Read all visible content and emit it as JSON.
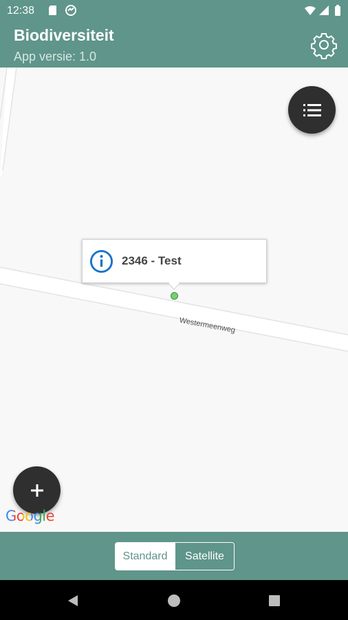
{
  "status_bar": {
    "time": "12:38"
  },
  "app_bar": {
    "title": "Biodiversiteit",
    "subtitle": "App versie: 1.0"
  },
  "map": {
    "info_window": {
      "text": "2346 - Test"
    },
    "street_name": "Westermeenweg",
    "attribution": "Google"
  },
  "map_type": {
    "options": [
      "Standard",
      "Satellite"
    ],
    "selected": "Standard"
  },
  "colors": {
    "primary": "#5f958a",
    "fab": "#2f2f2f",
    "marker": "#76d071",
    "info_icon": "#1a73c8"
  }
}
